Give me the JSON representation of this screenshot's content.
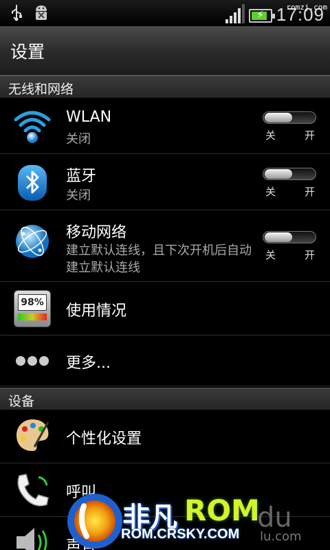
{
  "status_bar": {
    "time": "17:09",
    "watermark": "romzj.com",
    "icons": [
      "usb-icon",
      "android-debug-icon",
      "signal-icon",
      "battery-charging-icon"
    ],
    "battery_level": 0.85,
    "signal_level": 4
  },
  "header": {
    "title": "设置"
  },
  "sections": {
    "wireless": "无线和网络",
    "device": "设备"
  },
  "rows": {
    "wlan": {
      "label": "WLAN",
      "sub": "关闭",
      "off_label": "关",
      "on_label": "开",
      "on": false,
      "icon": "wifi-icon"
    },
    "bluetooth": {
      "label": "蓝牙",
      "sub": "关闭",
      "off_label": "关",
      "on_label": "开",
      "on": false,
      "icon": "bluetooth-icon"
    },
    "mobile": {
      "label": "移动网络",
      "sub": "建立默认连线，且下次开机后自动建立默认连线",
      "off_label": "关",
      "on_label": "开",
      "on": false,
      "icon": "globe-icon"
    },
    "usage": {
      "label": "使用情况",
      "icon": "usage-meter-icon",
      "meter_text": "98%"
    },
    "more": {
      "label": "更多...",
      "icon": "more-dots-icon"
    },
    "personalize": {
      "label": "个性化设置",
      "icon": "palette-icon"
    },
    "call": {
      "label": "呼叫",
      "icon": "phone-icon"
    },
    "sound": {
      "label": "声音",
      "icon": "speaker-icon"
    }
  },
  "watermark": {
    "brand": "非凡",
    "rom": "ROM",
    "url": "ROM.CRSKY.COM",
    "du": "du",
    "du_sub": "lu.com"
  },
  "colors": {
    "accent_blue": "#2a9fe0",
    "battery_green": "#5bd12a",
    "rom_yellow": "#d6f22c"
  }
}
